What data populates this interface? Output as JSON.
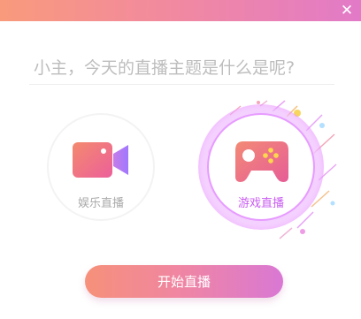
{
  "window": {
    "close_glyph": "✕",
    "accent_gradient": [
      "#f99a7c",
      "#e27ac8"
    ]
  },
  "topic": {
    "placeholder": "小主，今天的直播主题是什么是呢?",
    "value": ""
  },
  "modes": [
    {
      "label": "娱乐直播",
      "icon": "video-camera-icon",
      "selected": false
    },
    {
      "label": "游戏直播",
      "icon": "gamepad-icon",
      "selected": true
    }
  ],
  "start_button": {
    "label": "开始直播"
  },
  "colors": {
    "selected_label": "#c95cf1",
    "unselected_label": "#a9a9a9"
  }
}
